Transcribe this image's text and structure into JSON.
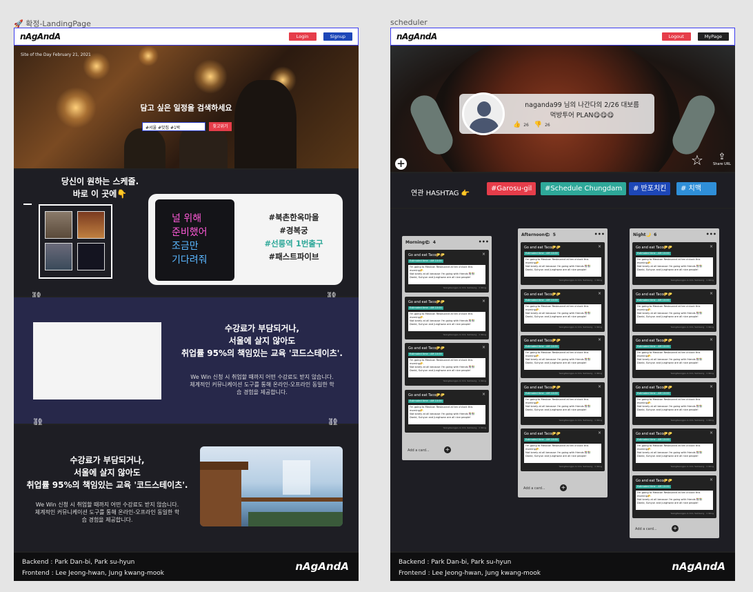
{
  "left_frame": {
    "label": "확정-LandingPage",
    "nav": {
      "logo": "nAgAndA",
      "login": "Login",
      "signup": "Signup"
    },
    "hero": {
      "site_of_day": "Site of the Day February 21, 2021",
      "title": "담고 싶은 일정을 검색하세요",
      "search_value": "#서울 #맛집 #1박",
      "search_button": "찾고위기"
    },
    "section1": {
      "title_line1": "당신이 원하는 스케줄.",
      "title_line2": "바로 이 곳에👇",
      "neon_lines": [
        "널  위해",
        "준비했어",
        "조금만",
        "기다려줘"
      ],
      "tags": [
        "#북촌한옥마을",
        "#경복궁",
        "#선릉역 1번출구",
        "#패스트파이브"
      ],
      "tag_colors": [
        "#ffffff",
        "#ffffff",
        "#4fd1c5",
        "#ffffff"
      ]
    },
    "section2": {
      "title_line1": "수강료가 부담되거나,",
      "title_line2": "서울에 살지 않아도",
      "title_line3": "취업률 95%의 책임있는 교육 '코드스테이츠'.",
      "body_line1": "We Win 신청 시 취업할 때까지 어떤 수강료도 받지 않습니다.",
      "body_line2": "체계적인 커뮤니케이션 도구를 통해 온라인-오프라인 동일한 학",
      "body_line3": "습 경험을 제공합니다."
    },
    "section3": {
      "title_line1": "수강료가 부담되거나,",
      "title_line2": "서울에 살지 않아도",
      "title_line3": "취업률 95%의 책임있는 교육 '코드스테이츠'.",
      "body_line1": "We Win 신청 시 취업할 때까지 어떤 수강료도 받지 않습니다.",
      "body_line2": "체계적인 커뮤니케이션 도구를 통해 온라인-오프라인 동일한 학",
      "body_line3": "습 경험을 제공합니다."
    },
    "footer": {
      "backend": "Backend : Park Dan-bi, Park su-hyun",
      "frontend": "Frontend :  Lee Jeong-hwan, Jung kwang-mook",
      "logo": "nAgAndA"
    }
  },
  "right_frame": {
    "label": "scheduler",
    "nav": {
      "logo": "nAgAndA",
      "logout": "Logout",
      "mypage": "MyPage"
    },
    "profile": {
      "title_line1": "naganda99 님의 나간다의 2/26 대보름",
      "title_line2": "먹방투어 PLAN😋😋😋",
      "likes": "26",
      "dislikes": "26",
      "share_label": "Share URL"
    },
    "hashtag": {
      "label": "연관 HASHTAG 👉",
      "tags": [
        {
          "text": "#Garosu-gil",
          "color": "#e63d4a"
        },
        {
          "text": "#Schedule Chungdam",
          "color": "#2ea899"
        },
        {
          "text": "# 반포치킨",
          "color": "#1d47b8"
        },
        {
          "text": "#   치맥",
          "color": "#2f8fd8"
        }
      ]
    },
    "columns": [
      {
        "title": "Morning🌤",
        "count": "4",
        "cards": 4
      },
      {
        "title": "Afternoon🌤",
        "count": "5",
        "cards": 5
      },
      {
        "title": "Night🌙",
        "count": "6",
        "cards": 6
      }
    ],
    "card": {
      "title": "Go and eat Taco🌮🌮",
      "badge": "Estimated time : AM 10:00",
      "body_line1": "I'm going to Mexican Restaurant  at ten o'clock this",
      "body_line2": "morning🌮.",
      "body_line3": "Not lonely at all because I'm going with friends 👫👫",
      "body_line4": "Danbi, Suhyun and Junghwan are all nice people!",
      "foot": "Yeongdeungpo-ro 111, Samsung  · 1 liking"
    },
    "add_card": "Add a card...",
    "footer": {
      "backend": "Backend : Park Dan-bi, Park su-hyun",
      "frontend": "Frontend :  Lee Jeong-hwan, Jung kwang-mook",
      "logo": "nAgAndA"
    }
  }
}
